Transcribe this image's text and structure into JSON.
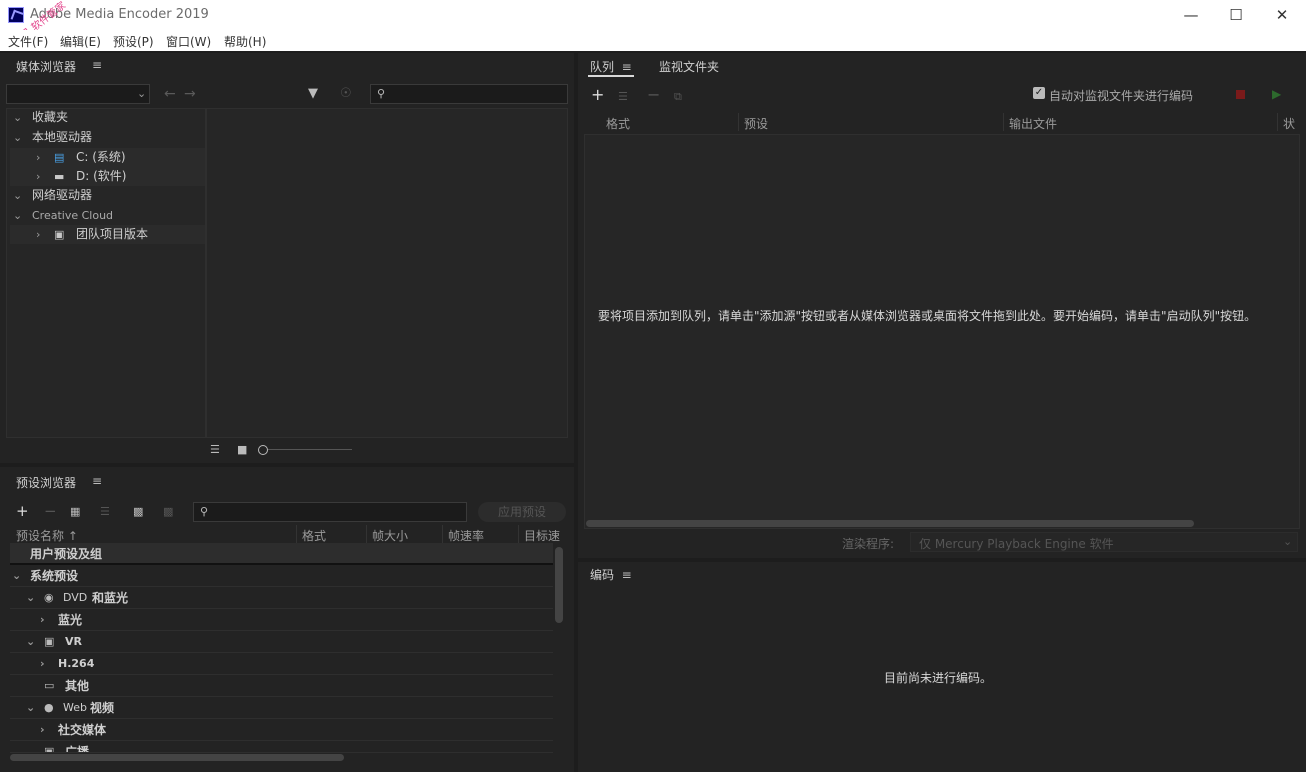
{
  "window": {
    "title": "Adobe Media Encoder 2019",
    "controls": [
      "minimize",
      "maximize",
      "close"
    ]
  },
  "menu": [
    "文件(F)",
    "编辑(E)",
    "预设(P)",
    "窗口(W)",
    "帮助(H)"
  ],
  "media_browser": {
    "title": "媒体浏览器",
    "search_placeholder": "",
    "tree": [
      {
        "label": "收藏夹",
        "expanded": true
      },
      {
        "label": "本地驱动器",
        "expanded": true
      },
      {
        "label": "C: (系统)",
        "icon": "drive-icon"
      },
      {
        "label": "D: (软件)",
        "icon": "drive-icon"
      },
      {
        "label": "网络驱动器",
        "expanded": true
      },
      {
        "label": "Creative Cloud",
        "expanded": true
      },
      {
        "label": "团队项目版本",
        "icon": "team-project-icon"
      }
    ]
  },
  "preset_browser": {
    "title": "预设浏览器",
    "apply_label": "应用预设",
    "columns": [
      "预设名称",
      "格式",
      "帧大小",
      "帧速率",
      "目标速"
    ],
    "rows": [
      {
        "label": "用户预设及组"
      },
      {
        "label": "系统预设"
      },
      {
        "prefix": "DVD",
        "label": "和蓝光"
      },
      {
        "label": "蓝光"
      },
      {
        "prefix": "VR",
        "label": ""
      },
      {
        "prefix": "H.264",
        "label": ""
      },
      {
        "label": "其他"
      },
      {
        "prefix": "Web",
        "label": "视频"
      },
      {
        "label": "社交媒体"
      },
      {
        "label": "广播"
      }
    ]
  },
  "queue": {
    "tabs": [
      "队列",
      "监视文件夹"
    ],
    "auto_encode_label": "自动对监视文件夹进行编码",
    "auto_encode_checked": true,
    "columns": [
      "格式",
      "预设",
      "输出文件",
      "状"
    ],
    "empty_message": "要将项目添加到队列，请单击\"添加源\"按钮或者从媒体浏览器或桌面将文件拖到此处。要开始编码，请单击\"启动队列\"按钮。",
    "renderer_label": "渲染程序:",
    "renderer_value": "仅 Mercury Playback Engine 软件"
  },
  "encoding": {
    "title": "编码",
    "empty_message": "目前尚未进行编码。"
  },
  "watermark": "公众号 软件管家"
}
